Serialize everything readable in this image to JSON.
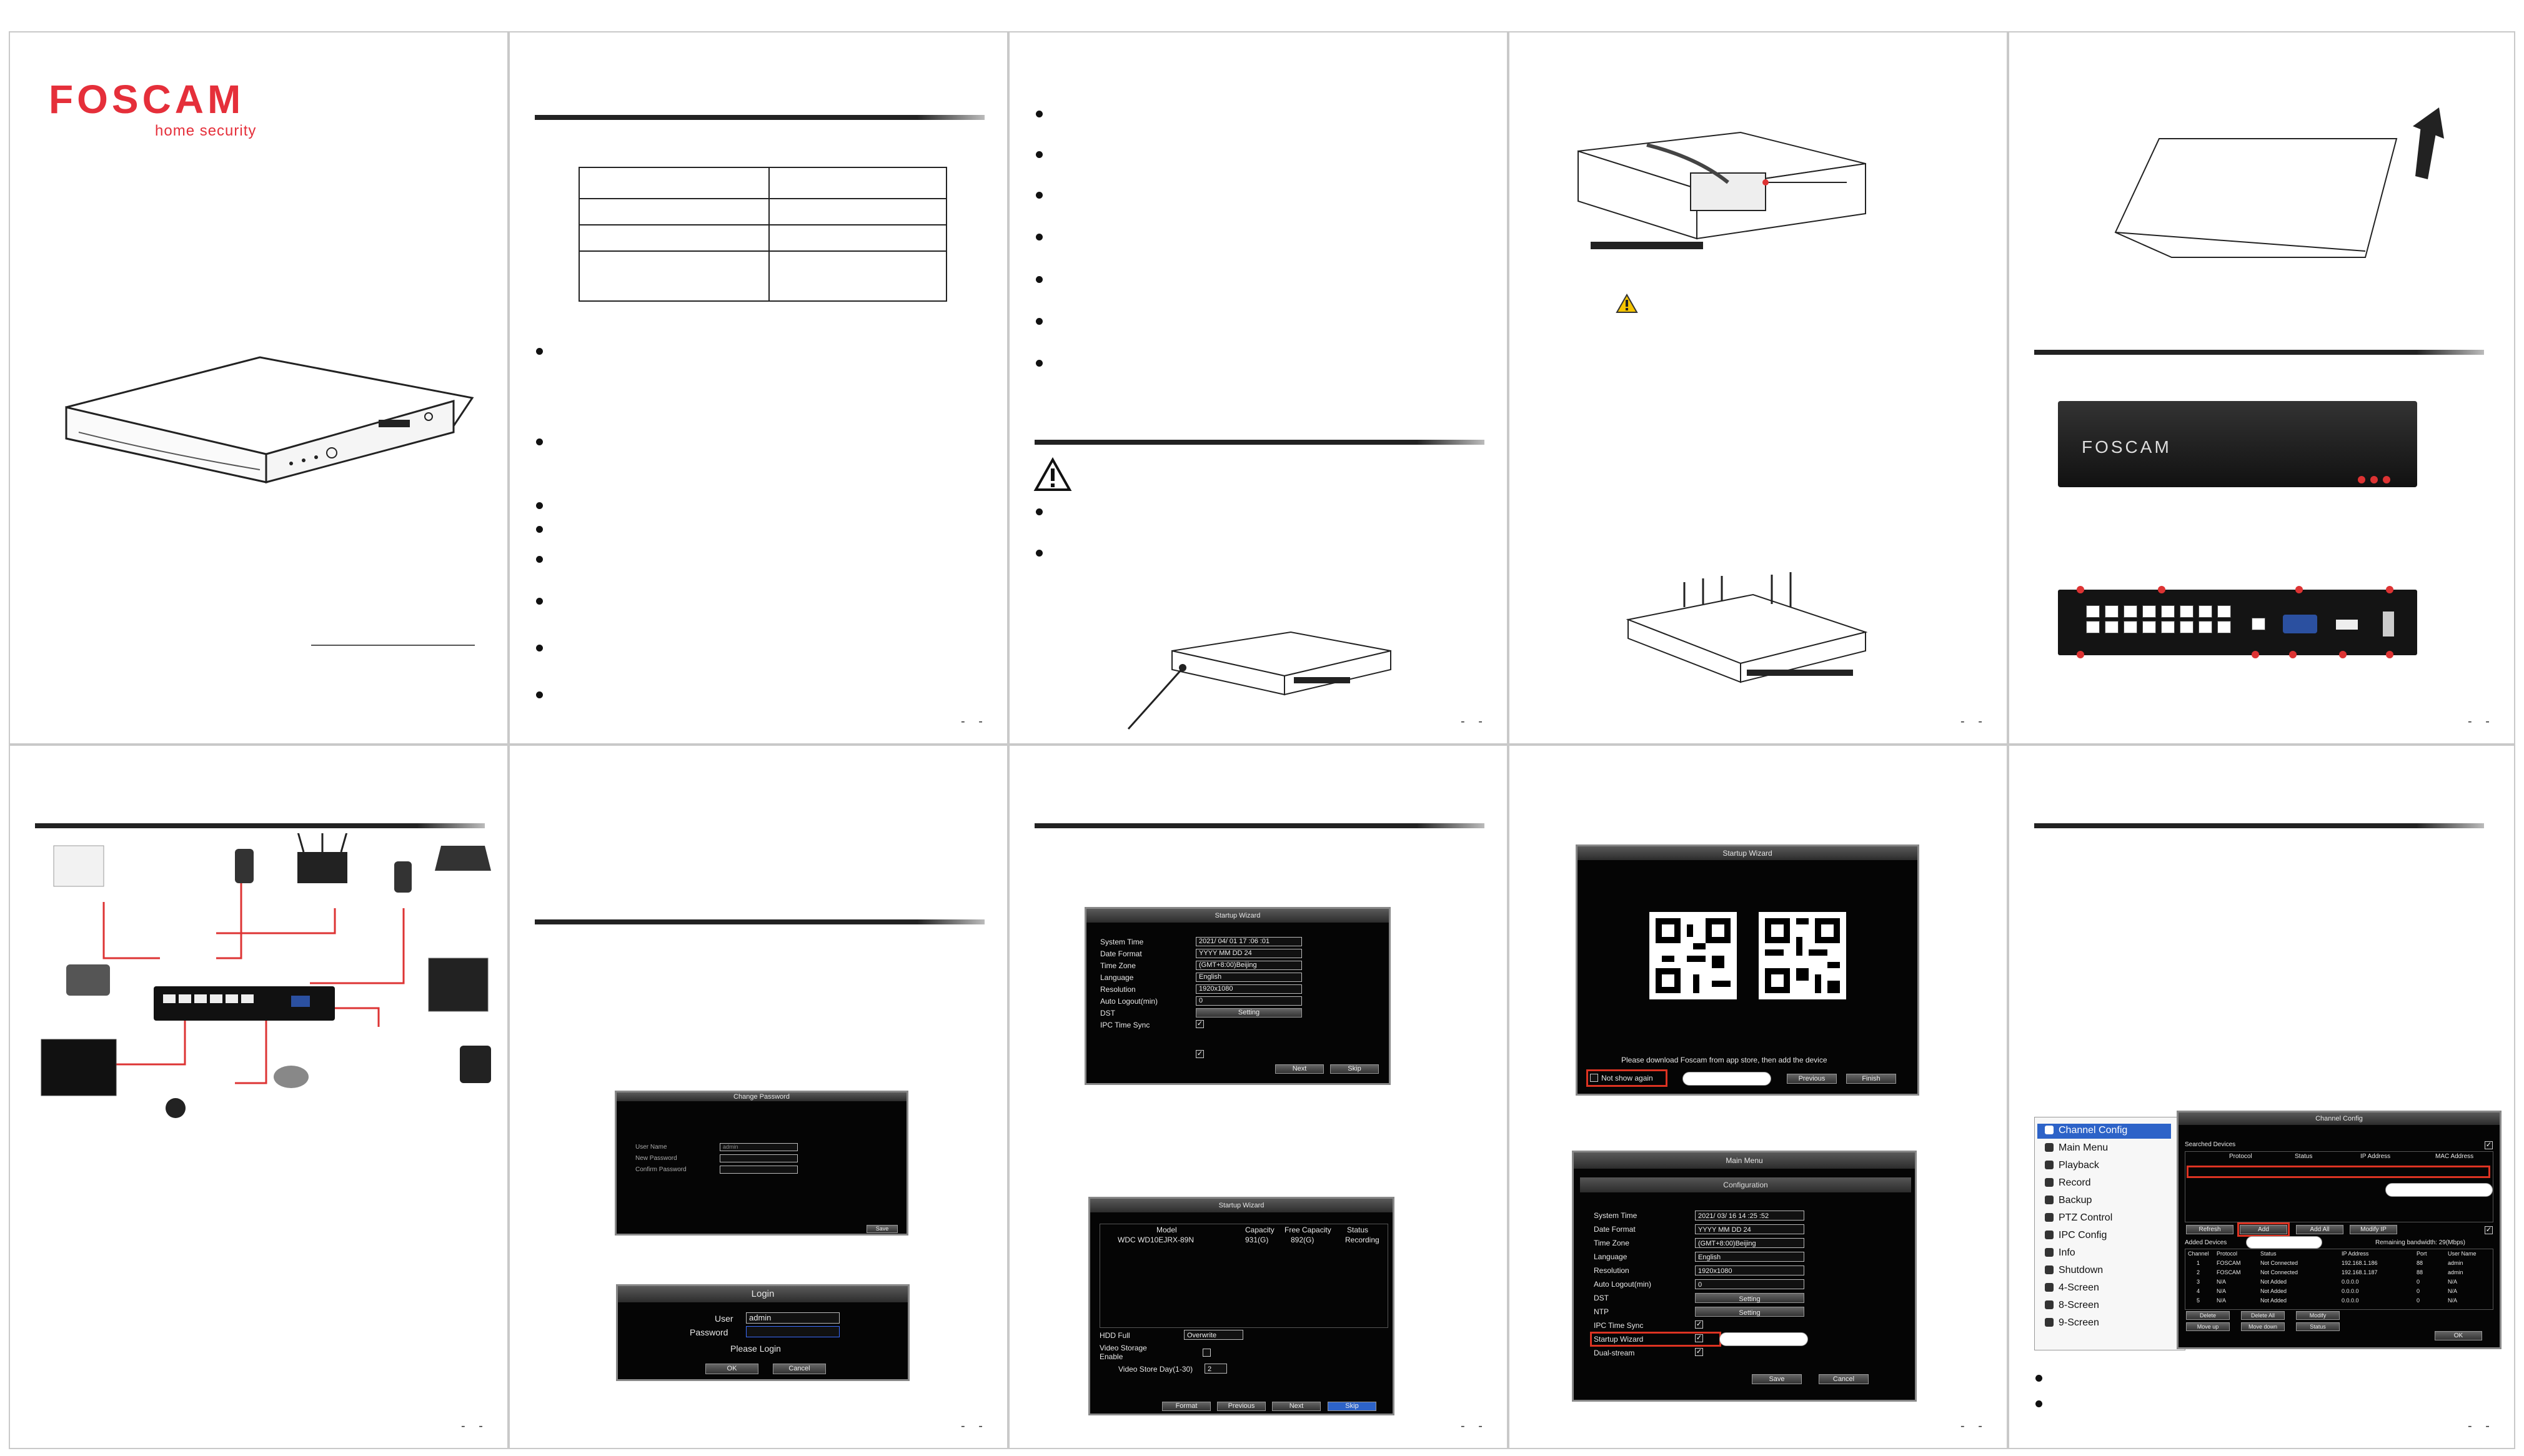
{
  "brand": {
    "logo_text": "FOSCAM",
    "tagline": "home security",
    "logo_color": "#e52f3a"
  },
  "colors": {
    "accent_red": "#d32f2f",
    "dialog_bg": "#050505",
    "selected_blue": "#2d63c8"
  },
  "page_numbers": [
    "-  -",
    "-  -",
    "-  -",
    "-  -",
    "-  -",
    "-  -",
    "-  -",
    "-  -"
  ],
  "nvr_front": {
    "brand_text": "FOSCAM"
  },
  "change_password_dialog": {
    "title": "Change Password",
    "fields": [
      {
        "label": "User Name",
        "value": "admin"
      },
      {
        "label": "New Password",
        "value": ""
      },
      {
        "label": "Confirm Password",
        "value": ""
      }
    ],
    "save_label": "Save"
  },
  "login_dialog": {
    "title": "Login",
    "user_label": "User",
    "user_value": "admin",
    "password_label": "Password",
    "prompt": "Please Login",
    "ok_label": "OK",
    "cancel_label": "Cancel"
  },
  "wizard_system": {
    "title": "Startup Wizard",
    "rows": [
      {
        "label": "System Time",
        "value": "2021/ 04/ 01   17 :06 :01"
      },
      {
        "label": "Date Format",
        "value": "YYYY MM DD 24"
      },
      {
        "label": "Time Zone",
        "value": "(GMT+8:00)Beijing"
      },
      {
        "label": "Language",
        "value": "English"
      },
      {
        "label": "Resolution",
        "value": "1920x1080"
      },
      {
        "label": "Auto Logout(min)",
        "value": "0"
      },
      {
        "label": "DST",
        "value": "Setting"
      },
      {
        "label": "IPC Time Sync",
        "value": "✓"
      }
    ],
    "next_label": "Next",
    "skip_label": "Skip"
  },
  "wizard_hdd": {
    "title": "Startup Wizard",
    "headers": [
      "Model",
      "Capacity",
      "Free Capacity",
      "Status"
    ],
    "rows": [
      {
        "model": "WDC WD10EJRX-89N",
        "capacity": "931(G)",
        "free": "892(G)",
        "status": "Recording"
      }
    ],
    "hdd_full_label": "HDD Full",
    "hdd_full_value": "Overwrite",
    "storage_enable_label": "Video Storage Enable",
    "store_days_label": "Video Store Day(1-30)",
    "store_days_value": "2",
    "buttons": [
      "Format",
      "Previous",
      "Next",
      "Skip"
    ]
  },
  "wizard_qr": {
    "title": "Startup Wizard",
    "message": "Please download Foscam from app store, then add the device",
    "not_show_label": "Not show again",
    "previous_label": "Previous",
    "finish_label": "Finish"
  },
  "main_menu_dialog": {
    "title": "Main Menu",
    "subtitle": "Configuration",
    "rows": [
      {
        "label": "System Time",
        "value": "2021/ 03/ 16   14 :25 :52"
      },
      {
        "label": "Date Format",
        "value": "YYYY MM DD 24"
      },
      {
        "label": "Time Zone",
        "value": "(GMT+8:00)Beijing"
      },
      {
        "label": "Language",
        "value": "English"
      },
      {
        "label": "Resolution",
        "value": "1920x1080"
      },
      {
        "label": "Auto Logout(min)",
        "value": "0"
      },
      {
        "label": "DST",
        "value": "Setting"
      },
      {
        "label": "NTP",
        "value": "Setting"
      },
      {
        "label": "IPC Time Sync",
        "value": "✓"
      },
      {
        "label": "Startup Wizard",
        "value": "✓"
      },
      {
        "label": "Dual-stream",
        "value": "✓"
      }
    ],
    "save_label": "Save",
    "cancel_label": "Cancel"
  },
  "context_menu": {
    "items": [
      "Channel Config",
      "Main Menu",
      "Playback",
      "Record",
      "Backup",
      "PTZ Control",
      "IPC Config",
      "Info",
      "Shutdown",
      "4-Screen",
      "8-Screen",
      "9-Screen"
    ]
  },
  "channel_config": {
    "title": "Channel Config",
    "searched_label": "Searched Devices",
    "searched_headers": [
      "Protocol",
      "Status",
      "IP Address",
      "MAC Address"
    ],
    "buttons_top": [
      "Refresh",
      "Add",
      "Add All",
      "Modify IP"
    ],
    "added_label": "Added Devices",
    "bandwidth": "Remaining bandwidth: 29(Mbps)",
    "added_headers": [
      "Channel",
      "Protocol",
      "Status",
      "IP Address",
      "Port",
      "User Name"
    ],
    "added_rows": [
      [
        "1",
        "FOSCAM",
        "Not Connected",
        "192.168.1.186",
        "88",
        "admin"
      ],
      [
        "2",
        "FOSCAM",
        "Not Connected",
        "192.168.1.187",
        "88",
        "admin"
      ],
      [
        "3",
        "N/A",
        "Not Added",
        "0.0.0.0",
        "0",
        "N/A"
      ],
      [
        "4",
        "N/A",
        "Not Added",
        "0.0.0.0",
        "0",
        "N/A"
      ],
      [
        "5",
        "N/A",
        "Not Added",
        "0.0.0.0",
        "0",
        "N/A"
      ]
    ],
    "buttons_bottom": [
      "Delete",
      "Delete All",
      "Modify",
      "Move up",
      "Move down",
      "Status"
    ],
    "ok_label": "OK"
  }
}
